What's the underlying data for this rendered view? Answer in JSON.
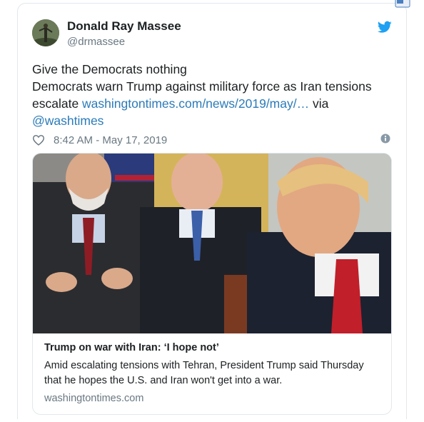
{
  "user": {
    "display_name": "Donald Ray Massee",
    "handle": "@drmassee"
  },
  "tweet": {
    "line1": "Give the Democrats nothing",
    "line2_prefix": "Democrats warn Trump against military force as Iran tensions escalate ",
    "link_text": "washingtontimes.com/news/2019/may/…",
    "via": " via ",
    "mention": "@washtimes"
  },
  "meta": {
    "timestamp": "8:42 AM - May 17, 2019"
  },
  "card": {
    "title": "Trump on war with Iran: ‘I hope not’",
    "description": "Amid escalating tensions with Tehran, President Trump said Thursday that he hopes the U.S. and Iran won't get into a war.",
    "domain": "washingtontimes.com"
  },
  "icons": {
    "twitter_bird": "twitter-bird-icon",
    "heart": "heart-icon",
    "info": "info-icon",
    "translate": "translate-icon"
  },
  "colors": {
    "link": "#2b7bb9",
    "twitter_blue": "#1da1f2",
    "muted": "#697882",
    "border": "#e1e8ed"
  }
}
